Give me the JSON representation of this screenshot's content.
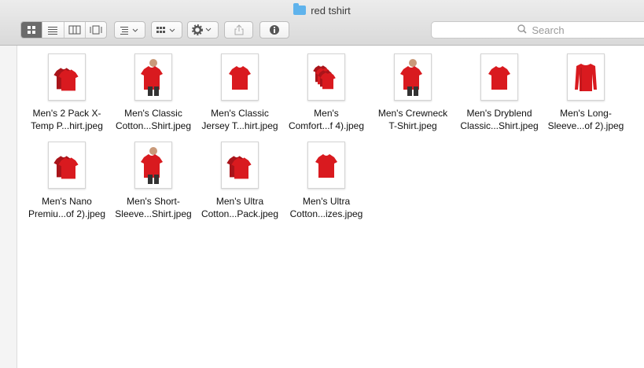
{
  "window": {
    "title": "red tshirt"
  },
  "toolbar": {
    "view_icons": [
      "icon-view-icon",
      "list-view-icon",
      "column-view-icon",
      "coverflow-view-icon"
    ],
    "search_placeholder": "Search"
  },
  "colors": {
    "shirt": "#d91a1f",
    "shirt_dark": "#a9141a",
    "folder": "#5fb3ec"
  },
  "files": [
    {
      "line1": "Men's 2 Pack X-",
      "line2": "Temp P...hirt.jpeg",
      "thumb": "two-pack"
    },
    {
      "line1": "Men's Classic",
      "line2": "Cotton...Shirt.jpeg",
      "thumb": "model"
    },
    {
      "line1": "Men's Classic",
      "line2": "Jersey T...hirt.jpeg",
      "thumb": "single"
    },
    {
      "line1": "Men's",
      "line2": "Comfort...f 4).jpeg",
      "thumb": "stack"
    },
    {
      "line1": "Men's Crewneck",
      "line2": "T-Shirt.jpeg",
      "thumb": "model"
    },
    {
      "line1": "Men's Dryblend",
      "line2": "Classic...Shirt.jpeg",
      "thumb": "single"
    },
    {
      "line1": "Men's Long-",
      "line2": "Sleeve...of 2).jpeg",
      "thumb": "longsleeve"
    },
    {
      "line1": "Men's Nano",
      "line2": "Premiu...of 2).jpeg",
      "thumb": "two-pack"
    },
    {
      "line1": "Men's Short-",
      "line2": "Sleeve...Shirt.jpeg",
      "thumb": "model"
    },
    {
      "line1": "Men's Ultra",
      "line2": "Cotton...Pack.jpeg",
      "thumb": "two-pack"
    },
    {
      "line1": "Men's Ultra",
      "line2": "Cotton...izes.jpeg",
      "thumb": "single"
    }
  ]
}
